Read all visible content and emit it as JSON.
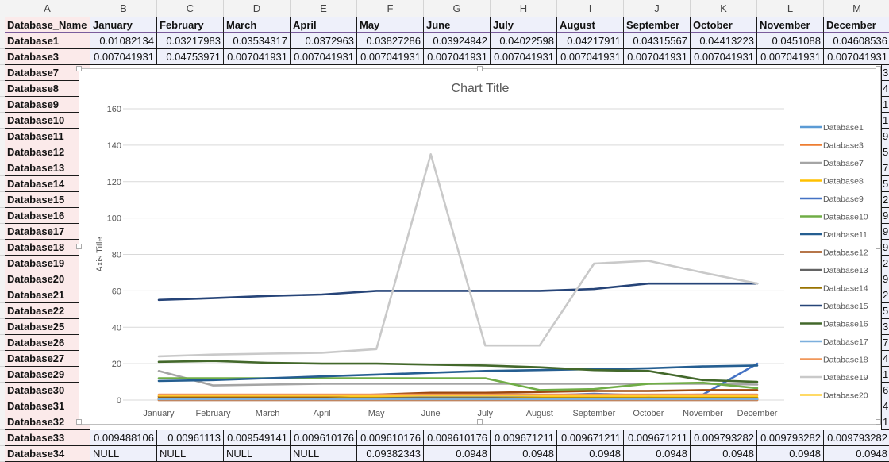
{
  "column_headers": [
    "A",
    "B",
    "C",
    "D",
    "E",
    "F",
    "G",
    "H",
    "I",
    "J",
    "K",
    "L",
    "M"
  ],
  "header_row": [
    "Database_Name",
    "January",
    "February",
    "March",
    "April",
    "May",
    "June",
    "July",
    "August",
    "September",
    "October",
    "November",
    "December"
  ],
  "top_rows": [
    {
      "name": "Database1",
      "values": [
        "0.01082134",
        "0.03217983",
        "0.03534317",
        "0.0372963",
        "0.03827286",
        "0.03924942",
        "0.04022598",
        "0.04217911",
        "0.04315567",
        "0.04413223",
        "0.0451088",
        "0.04608536"
      ]
    },
    {
      "name": "Database3",
      "values": [
        "0.007041931",
        "0.04753971",
        "0.007041931",
        "0.007041931",
        "0.007041931",
        "0.007041931",
        "0.007041931",
        "0.007041931",
        "0.007041931",
        "0.007041931",
        "0.007041931",
        "0.007041931"
      ]
    }
  ],
  "hidden_rows": [
    {
      "name": "Database7",
      "edge": "3"
    },
    {
      "name": "Database8",
      "edge": "4"
    },
    {
      "name": "Database9",
      "edge": "1"
    },
    {
      "name": "Database10",
      "edge": "1"
    },
    {
      "name": "Database11",
      "edge": "9"
    },
    {
      "name": "Database12",
      "edge": "5"
    },
    {
      "name": "Database13",
      "edge": "7"
    },
    {
      "name": "Database14",
      "edge": "5"
    },
    {
      "name": "Database15",
      "edge": "2"
    },
    {
      "name": "Database16",
      "edge": "9"
    },
    {
      "name": "Database17",
      "edge": "9"
    },
    {
      "name": "Database18",
      "edge": "9"
    },
    {
      "name": "Database19",
      "edge": "2"
    },
    {
      "name": "Database20",
      "edge": "9"
    },
    {
      "name": "Database21",
      "edge": "2"
    },
    {
      "name": "Database22",
      "edge": "5"
    },
    {
      "name": "Database25",
      "edge": "3"
    },
    {
      "name": "Database26",
      "edge": "7"
    },
    {
      "name": "Database27",
      "edge": "4"
    },
    {
      "name": "Database29",
      "edge": "1"
    },
    {
      "name": "Database30",
      "edge": "6"
    },
    {
      "name": "Database31",
      "edge": "4"
    },
    {
      "name": "Database32",
      "edge": "1"
    }
  ],
  "bottom_rows": [
    {
      "name": "Database33",
      "values": [
        "0.009488106",
        "0.00961113",
        "0.009549141",
        "0.009610176",
        "0.009610176",
        "0.009610176",
        "0.009671211",
        "0.009671211",
        "0.009671211",
        "0.009793282",
        "0.009793282",
        "0.009793282"
      ],
      "align": [
        "num",
        "num",
        "num",
        "num",
        "num",
        "num",
        "num",
        "num",
        "num",
        "num",
        "num",
        "num"
      ]
    },
    {
      "name": "Database34",
      "values": [
        "NULL",
        "NULL",
        "NULL",
        "NULL",
        "0.09382343",
        "0.0948",
        "0.0948",
        "0.0948",
        "0.0948",
        "0.0948",
        "0.0948",
        "0.0948"
      ],
      "align": [
        "txt",
        "txt",
        "txt",
        "txt",
        "num",
        "num",
        "num",
        "num",
        "num",
        "num",
        "num",
        "num"
      ]
    }
  ],
  "chart_data": {
    "type": "line",
    "title": "Chart Title",
    "xlabel": "",
    "ylabel": "Axis Title",
    "ylim": [
      0,
      160
    ],
    "yticks": [
      "0",
      "20",
      "40",
      "60",
      "80",
      "100",
      "120",
      "140",
      "160"
    ],
    "grid": true,
    "legend_position": "right",
    "categories": [
      "January",
      "February",
      "March",
      "April",
      "May",
      "June",
      "July",
      "August",
      "September",
      "October",
      "November",
      "December"
    ],
    "series": [
      {
        "name": "Database1",
        "color": "#5b9bd5",
        "values": [
          0.01,
          0.03,
          0.04,
          0.04,
          0.04,
          0.04,
          0.04,
          0.04,
          0.04,
          0.04,
          0.05,
          0.05
        ]
      },
      {
        "name": "Database3",
        "color": "#ed7d31",
        "values": [
          0.01,
          0.05,
          0.01,
          0.01,
          0.01,
          0.01,
          0.01,
          0.01,
          0.01,
          0.01,
          0.01,
          0.01
        ]
      },
      {
        "name": "Database7",
        "color": "#a5a5a5",
        "values": [
          16,
          8,
          8.5,
          9,
          9,
          9,
          9,
          9,
          9,
          9,
          9,
          8.5
        ]
      },
      {
        "name": "Database8",
        "color": "#ffc000",
        "values": [
          1.5,
          1.5,
          1.5,
          1.5,
          1.5,
          1.5,
          1.5,
          1.5,
          1.5,
          1.5,
          1.5,
          1.5
        ]
      },
      {
        "name": "Database9",
        "color": "#4472c4",
        "values": [
          1,
          1,
          1,
          1,
          1,
          1.5,
          2,
          2.5,
          3.5,
          2.5,
          3,
          20
        ]
      },
      {
        "name": "Database10",
        "color": "#70ad47",
        "values": [
          12,
          12,
          12,
          12,
          12,
          12,
          12,
          5.5,
          6,
          9,
          9.5,
          6.5
        ]
      },
      {
        "name": "Database11",
        "color": "#255e91",
        "values": [
          10.5,
          11,
          12,
          13,
          14,
          15,
          16,
          16.5,
          17,
          17.5,
          18.5,
          19
        ]
      },
      {
        "name": "Database12",
        "color": "#9e480e",
        "values": [
          2,
          2,
          2,
          2,
          3,
          4,
          4,
          4.5,
          5,
          5,
          5.5,
          5.5
        ]
      },
      {
        "name": "Database13",
        "color": "#636363",
        "values": [
          0.5,
          0.5,
          0.5,
          0.5,
          0.5,
          0.5,
          0.5,
          0.5,
          0.5,
          0.5,
          0.5,
          0.5
        ]
      },
      {
        "name": "Database14",
        "color": "#997300",
        "values": [
          1,
          1,
          1,
          1,
          1,
          1,
          1,
          1,
          1,
          1,
          1,
          1
        ]
      },
      {
        "name": "Database15",
        "color": "#264478",
        "values": [
          55,
          56,
          57.2,
          58,
          60,
          60,
          60,
          60,
          61,
          64,
          64,
          64
        ]
      },
      {
        "name": "Database16",
        "color": "#43682b",
        "values": [
          21,
          21.5,
          20.5,
          20,
          20,
          19.5,
          19,
          18,
          16.5,
          16,
          11,
          10
        ]
      },
      {
        "name": "Database17",
        "color": "#7cafdd",
        "values": [
          0.5,
          0.5,
          0.5,
          0.5,
          0.5,
          0.5,
          0.5,
          0.5,
          0.5,
          0.5,
          0.5,
          0.5
        ]
      },
      {
        "name": "Database18",
        "color": "#f1975a",
        "values": [
          3,
          3,
          3,
          3,
          3,
          3,
          3,
          3,
          3,
          3,
          3,
          3
        ]
      },
      {
        "name": "Database19",
        "color": "#c9c9c9",
        "values": [
          24,
          25,
          25.5,
          26,
          28,
          135,
          30,
          30,
          75,
          76.5,
          70,
          64
        ]
      },
      {
        "name": "Database20",
        "color": "#ffcd33",
        "values": [
          2.5,
          2.5,
          2.5,
          2.5,
          2.5,
          2.5,
          2.5,
          2.5,
          2.5,
          2.5,
          2.5,
          2.5
        ]
      }
    ]
  }
}
